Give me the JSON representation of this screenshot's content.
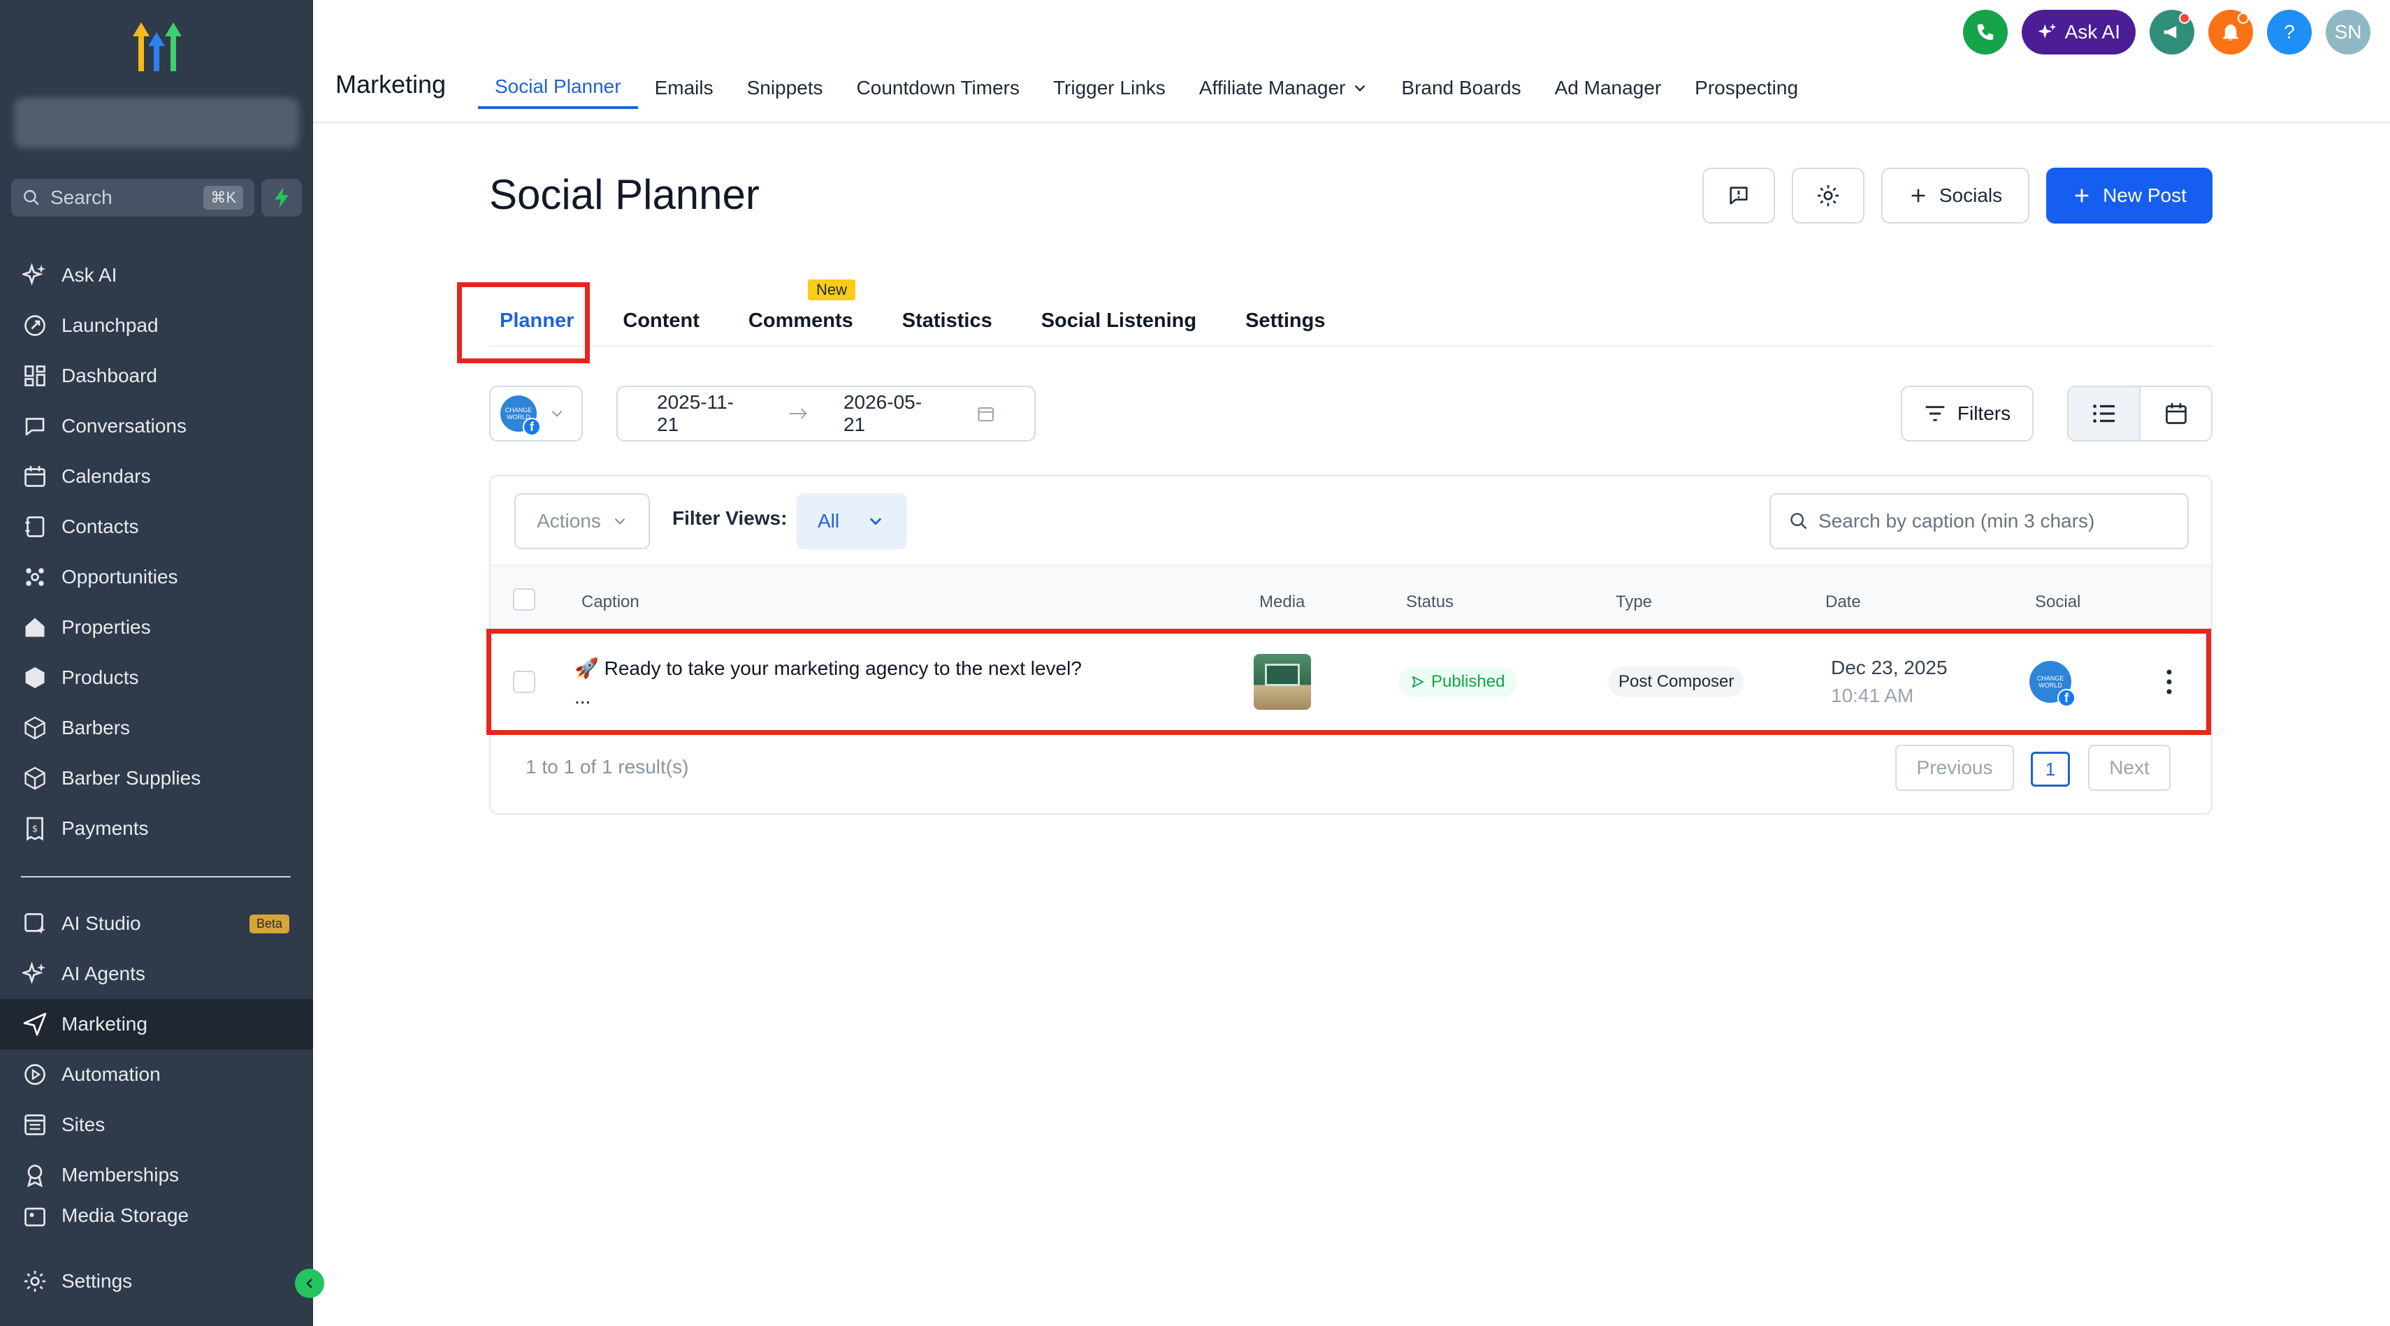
{
  "sidebar": {
    "search_placeholder": "Search",
    "search_shortcut": "⌘K",
    "items": [
      {
        "label": "Ask AI",
        "icon": "sparkles-icon"
      },
      {
        "label": "Launchpad",
        "icon": "rocket-icon"
      },
      {
        "label": "Dashboard",
        "icon": "dashboard-icon"
      },
      {
        "label": "Conversations",
        "icon": "chat-icon"
      },
      {
        "label": "Calendars",
        "icon": "calendar-icon"
      },
      {
        "label": "Contacts",
        "icon": "contacts-icon"
      },
      {
        "label": "Opportunities",
        "icon": "opportunities-icon"
      },
      {
        "label": "Properties",
        "icon": "home-icon"
      },
      {
        "label": "Products",
        "icon": "box-icon"
      },
      {
        "label": "Barbers",
        "icon": "box-icon"
      },
      {
        "label": "Barber Supplies",
        "icon": "box-icon"
      },
      {
        "label": "Payments",
        "icon": "receipt-icon"
      }
    ],
    "items2": [
      {
        "label": "AI Studio",
        "icon": "ai-studio-icon",
        "badge": "Beta"
      },
      {
        "label": "AI Agents",
        "icon": "sparkles-icon"
      },
      {
        "label": "Marketing",
        "icon": "send-icon",
        "active": true
      },
      {
        "label": "Automation",
        "icon": "play-circle-icon"
      },
      {
        "label": "Sites",
        "icon": "sites-icon"
      },
      {
        "label": "Memberships",
        "icon": "award-icon"
      },
      {
        "label": "Media Storage",
        "icon": "image-icon"
      }
    ],
    "settings_label": "Settings"
  },
  "topbar": {
    "section": "Marketing",
    "nav": [
      "Social Planner",
      "Emails",
      "Snippets",
      "Countdown Timers",
      "Trigger Links",
      "Affiliate Manager",
      "Brand Boards",
      "Ad Manager",
      "Prospecting"
    ],
    "active_nav": "Social Planner",
    "ask_ai_label": "Ask AI",
    "user_initials": "SN"
  },
  "page": {
    "title": "Social Planner",
    "socials_label": "Socials",
    "new_post_label": "New Post",
    "tabs": [
      "Planner",
      "Content",
      "Comments",
      "Statistics",
      "Social Listening",
      "Settings"
    ],
    "active_tab": "Planner",
    "new_badge": "New",
    "date_from": "2025-11-21",
    "date_to": "2026-05-21",
    "filters_label": "Filters",
    "actions_label": "Actions",
    "filter_views_label": "Filter Views:",
    "filter_views_value": "All",
    "search_placeholder": "Search by caption (min 3 chars)"
  },
  "table": {
    "columns": [
      "Caption",
      "Media",
      "Status",
      "Type",
      "Date",
      "Social"
    ],
    "rows": [
      {
        "caption": "🚀 Ready to take your marketing agency to the next level?",
        "caption_more": "...",
        "status": "Published",
        "type": "Post Composer",
        "date": "Dec 23, 2025",
        "time": "10:41 AM",
        "social_avatar_text": "CHANGE WORLD"
      }
    ],
    "results_text": "1 to 1 of 1 result(s)",
    "prev_label": "Previous",
    "page_number": "1",
    "next_label": "Next"
  },
  "colors": {
    "sidebar_bg": "#2f3a4a",
    "accent": "#155eef",
    "highlight": "#e5261f",
    "published": "#16a34a"
  }
}
